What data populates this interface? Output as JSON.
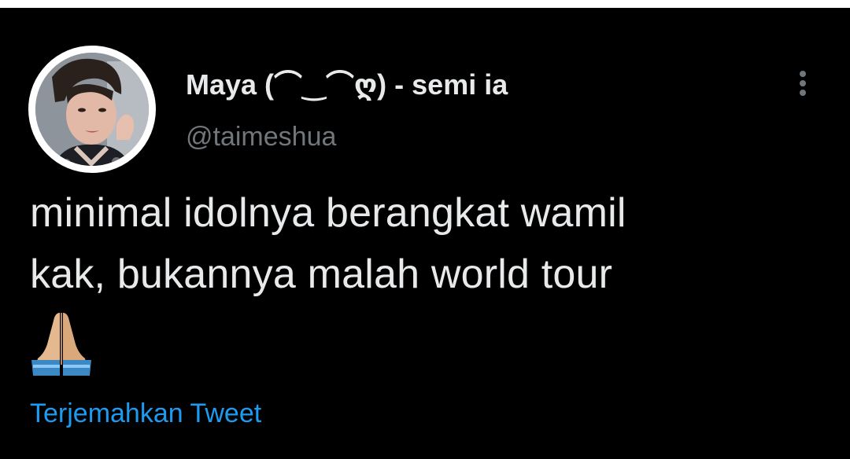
{
  "tweet": {
    "author": {
      "display_name": "Maya (⌒‿⌒ღ) - semi ia",
      "handle": "@taimeshua"
    },
    "text_lines": [
      "minimal idolnya berangkat wamil",
      "kak, bukannya malah world tour"
    ],
    "emoji": "folded-hands",
    "translate_label": "Terjemahkan Tweet"
  },
  "icons": {
    "more": "more-vertical-icon",
    "emoji": "folded-hands-icon"
  },
  "colors": {
    "background": "#000000",
    "text_primary": "#e7e9ea",
    "text_secondary": "#71767b",
    "link": "#1d9bf0"
  }
}
